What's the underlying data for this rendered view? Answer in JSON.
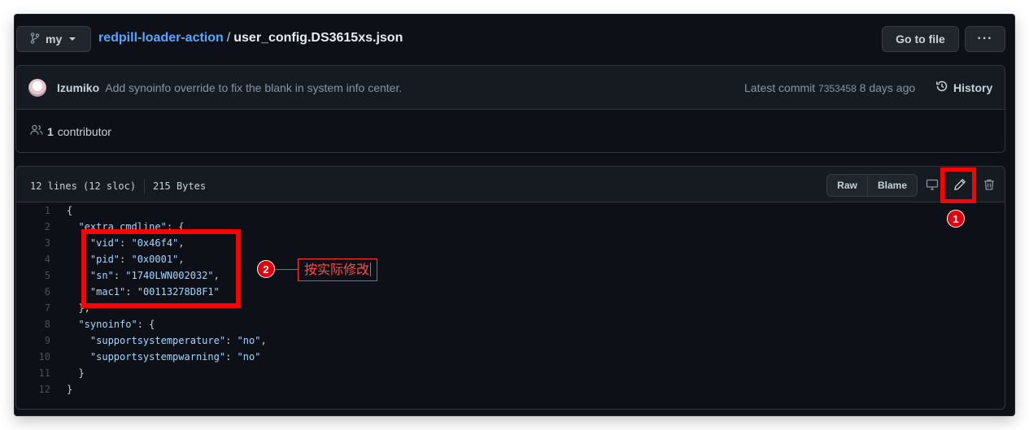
{
  "header": {
    "branch": "my",
    "repo": "redpill-loader-action",
    "separator": "/",
    "file": "user_config.DS3615xs.json",
    "goto_label": "Go to file",
    "more_label": "···"
  },
  "commit": {
    "author": "Izumiko",
    "message": "Add synoinfo override to fix the blank in system info center.",
    "latest_label": "Latest commit",
    "sha": "7353458",
    "time": "8 days ago",
    "history_label": "History",
    "contributors_count": "1",
    "contributors_label": "contributor"
  },
  "file": {
    "lines_info": "12 lines (12 sloc)",
    "size": "215 Bytes",
    "raw_label": "Raw",
    "blame_label": "Blame"
  },
  "code_lines": [
    {
      "n": "1",
      "indent": 0,
      "parts": [
        [
          "pun",
          "{"
        ]
      ]
    },
    {
      "n": "2",
      "indent": 1,
      "parts": [
        [
          "key",
          "\"extra_cmdline\""
        ],
        [
          "pun",
          ": {"
        ]
      ]
    },
    {
      "n": "3",
      "indent": 2,
      "parts": [
        [
          "key",
          "\"vid\""
        ],
        [
          "pun",
          ": "
        ],
        [
          "str",
          "\"0x46f4\""
        ],
        [
          "pun",
          ","
        ]
      ]
    },
    {
      "n": "4",
      "indent": 2,
      "parts": [
        [
          "key",
          "\"pid\""
        ],
        [
          "pun",
          ": "
        ],
        [
          "str",
          "\"0x0001\""
        ],
        [
          "pun",
          ","
        ]
      ]
    },
    {
      "n": "5",
      "indent": 2,
      "parts": [
        [
          "key",
          "\"sn\""
        ],
        [
          "pun",
          ": "
        ],
        [
          "str",
          "\"1740LWN002032\""
        ],
        [
          "pun",
          ","
        ]
      ]
    },
    {
      "n": "6",
      "indent": 2,
      "parts": [
        [
          "key",
          "\"mac1\""
        ],
        [
          "pun",
          ": "
        ],
        [
          "str",
          "\"00113278D8F1\""
        ]
      ]
    },
    {
      "n": "7",
      "indent": 1,
      "parts": [
        [
          "pun",
          "},"
        ]
      ]
    },
    {
      "n": "8",
      "indent": 1,
      "parts": [
        [
          "key",
          "\"synoinfo\""
        ],
        [
          "pun",
          ": {"
        ]
      ]
    },
    {
      "n": "9",
      "indent": 2,
      "parts": [
        [
          "key",
          "\"supportsystemperature\""
        ],
        [
          "pun",
          ": "
        ],
        [
          "str",
          "\"no\""
        ],
        [
          "pun",
          ","
        ]
      ]
    },
    {
      "n": "10",
      "indent": 2,
      "parts": [
        [
          "key",
          "\"supportsystempwarning\""
        ],
        [
          "pun",
          ": "
        ],
        [
          "str",
          "\"no\""
        ]
      ]
    },
    {
      "n": "11",
      "indent": 1,
      "parts": [
        [
          "pun",
          "}"
        ]
      ]
    },
    {
      "n": "12",
      "indent": 0,
      "parts": [
        [
          "pun",
          "}"
        ]
      ]
    }
  ],
  "annotations": {
    "badge1": "1",
    "badge2": "2",
    "note": "按实际修改"
  },
  "icons": {
    "branch": "git-branch-icon",
    "history": "history-icon",
    "people": "people-icon",
    "desktop": "desktop-icon",
    "edit": "pencil-icon",
    "delete": "trash-icon"
  }
}
